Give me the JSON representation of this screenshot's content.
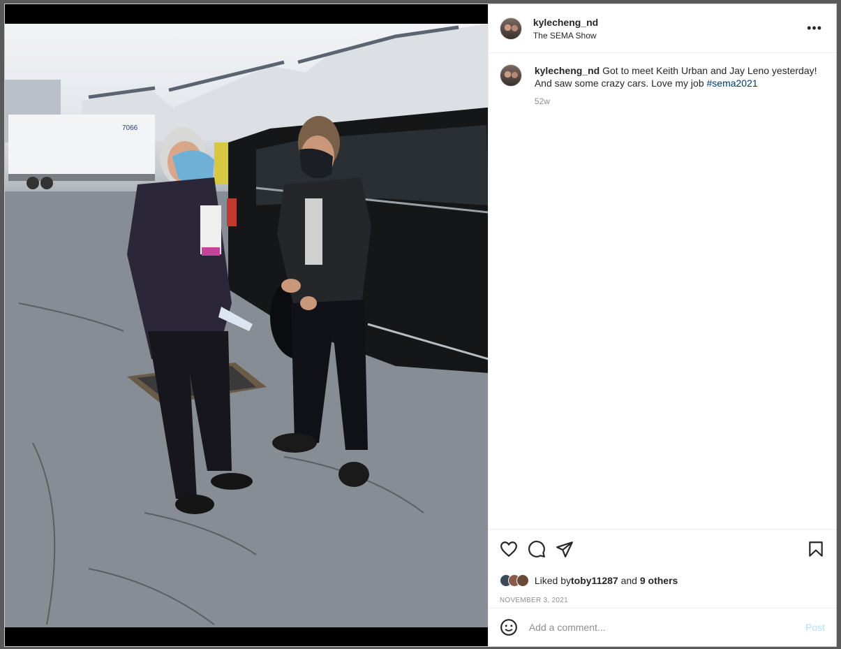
{
  "post": {
    "username": "kylecheng_nd",
    "location": "The SEMA Show",
    "more_icon": "more-horizontal-icon",
    "caption": {
      "username": "kylecheng_nd",
      "text": "Got to meet Keith Urban and Jay Leno yesterday! And saw some crazy cars. Love my job ",
      "hashtag": "#sema2021",
      "time_ago": "52w"
    },
    "actions": {
      "like_icon": "heart-icon",
      "comment_icon": "comment-icon",
      "share_icon": "send-icon",
      "save_icon": "bookmark-icon"
    },
    "likes": {
      "prefix": "Liked by ",
      "user": "toby11287",
      "middle": " and ",
      "others": "9 others"
    },
    "date": "NOVEMBER 3, 2021",
    "comment": {
      "emoji_icon": "emoji-icon",
      "placeholder": "Add a comment...",
      "post_label": "Post"
    }
  },
  "colors": {
    "accent_link": "#00376b",
    "post_button_disabled": "#b2dffc",
    "text": "#262626",
    "muted": "#8e8e8e"
  }
}
